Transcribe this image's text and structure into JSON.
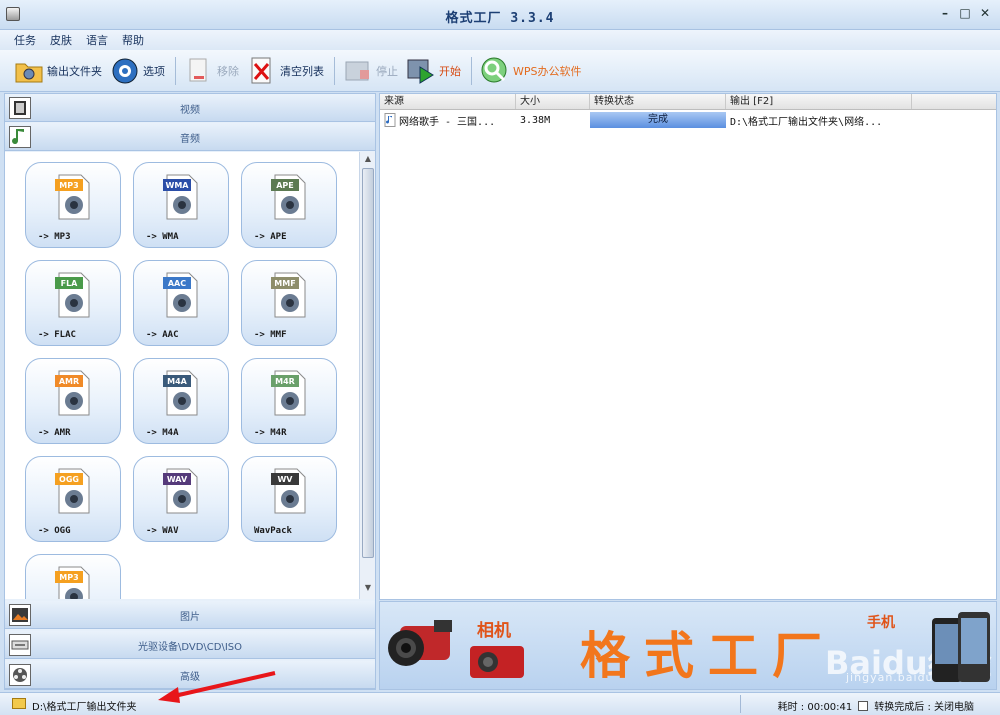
{
  "window": {
    "title": "格式工厂  3.3.4"
  },
  "menu": [
    "任务",
    "皮肤",
    "语言",
    "帮助"
  ],
  "toolbar": {
    "output_folder": "输出文件夹",
    "options": "选项",
    "remove": "移除",
    "clear_list": "清空列表",
    "stop": "停止",
    "start": "开始",
    "wps": "WPS办公软件"
  },
  "categories": {
    "video": "视频",
    "audio": "音频",
    "picture": "图片",
    "rom": "光驱设备\\DVD\\CD\\ISO",
    "advanced": "高级"
  },
  "formats": [
    {
      "tag": "MP3",
      "label": "-> MP3",
      "color": "#f5a020"
    },
    {
      "tag": "WMA",
      "label": "-> WMA",
      "color": "#2b4ea8"
    },
    {
      "tag": "APE",
      "label": "-> APE",
      "color": "#5c7a52"
    },
    {
      "tag": "FLA",
      "label": "-> FLAC",
      "color": "#4a9a4a"
    },
    {
      "tag": "AAC",
      "label": "-> AAC",
      "color": "#3b78c8"
    },
    {
      "tag": "MMF",
      "label": "-> MMF",
      "color": "#8d8d6a"
    },
    {
      "tag": "AMR",
      "label": "-> AMR",
      "color": "#f08a28"
    },
    {
      "tag": "M4A",
      "label": "-> M4A",
      "color": "#3a5a7a"
    },
    {
      "tag": "M4R",
      "label": "-> M4R",
      "color": "#6aa06a"
    },
    {
      "tag": "OGG",
      "label": "-> OGG",
      "color": "#f5a020"
    },
    {
      "tag": "WAV",
      "label": "-> WAV",
      "color": "#553a7a"
    },
    {
      "tag": "WV",
      "label": "WavPack",
      "color": "#3a3a3a"
    },
    {
      "tag": "MP3",
      "label": "",
      "color": "#f5a020"
    }
  ],
  "task_list": {
    "columns": [
      "来源",
      "大小",
      "转换状态",
      "输出 [F2]"
    ],
    "rows": [
      {
        "source": "网络歌手 - 三国...",
        "size": "3.38M",
        "status": "完成",
        "output": "D:\\格式工厂输出文件夹\\网络..."
      }
    ]
  },
  "banner": {
    "camera": "相机",
    "phone": "手机",
    "brand": "格式工厂",
    "watermark": "Baidu经验",
    "watermark_url": "jingyan.baidu.com"
  },
  "statusbar": {
    "path": "D:\\格式工厂输出文件夹",
    "elapsed": "耗时 : 00:00:41",
    "after_done": "转换完成后 : 关闭电脑"
  }
}
